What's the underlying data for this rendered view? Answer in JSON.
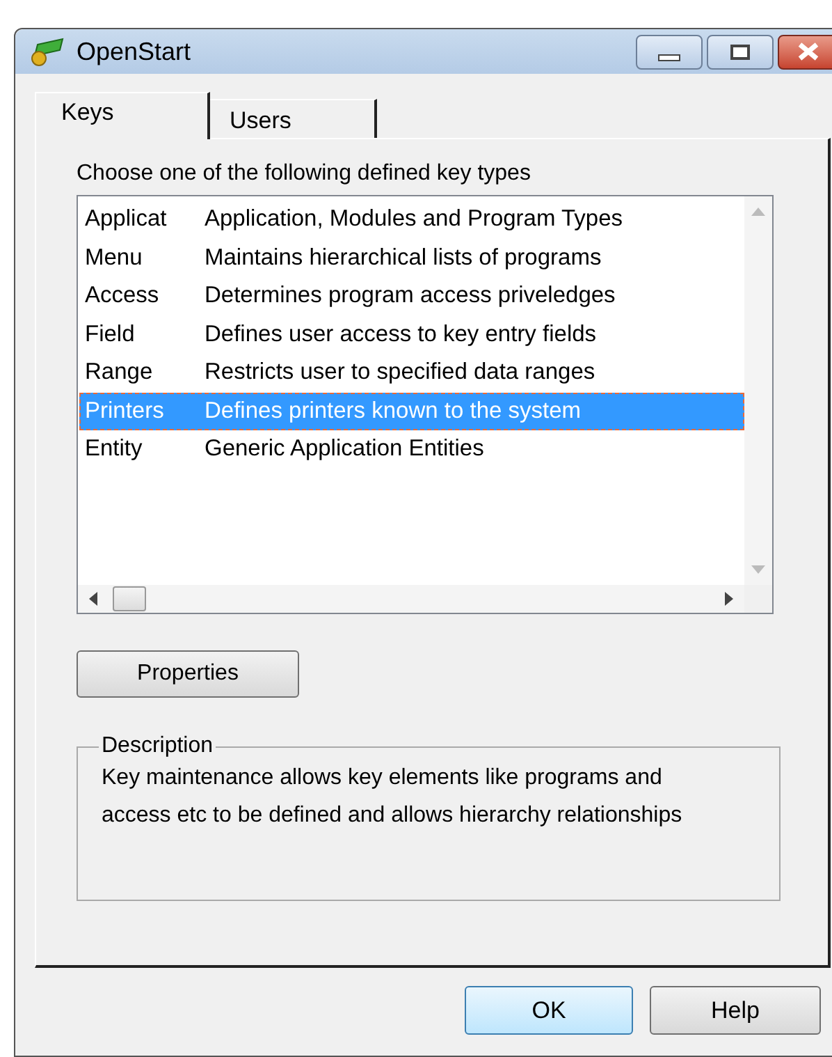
{
  "window": {
    "title": "OpenStart"
  },
  "tabs": [
    {
      "label": "Keys",
      "selected": true
    },
    {
      "label": "Users",
      "selected": false
    }
  ],
  "list": {
    "caption": "Choose one of the following defined key types",
    "rows": [
      {
        "key": "Applicat",
        "description": "Application, Modules and Program Types",
        "selected": false
      },
      {
        "key": "Menu",
        "description": "Maintains hierarchical lists of programs",
        "selected": false
      },
      {
        "key": "Access",
        "description": "Determines program access priveledges",
        "selected": false
      },
      {
        "key": "Field",
        "description": "Defines user access to key entry fields",
        "selected": false
      },
      {
        "key": "Range",
        "description": "Restricts user to specified data ranges",
        "selected": false
      },
      {
        "key": "Printers",
        "description": "Defines printers known to the system",
        "selected": true
      },
      {
        "key": "Entity",
        "description": "Generic Application Entities",
        "selected": false
      }
    ]
  },
  "properties_button": "Properties",
  "description": {
    "legend": "Description",
    "text": "Key maintenance allows key elements like programs and access etc to be defined and allows hierarchy relationships"
  },
  "buttons": [
    {
      "label": "OK",
      "default": true
    },
    {
      "label": "Help",
      "default": false
    }
  ]
}
